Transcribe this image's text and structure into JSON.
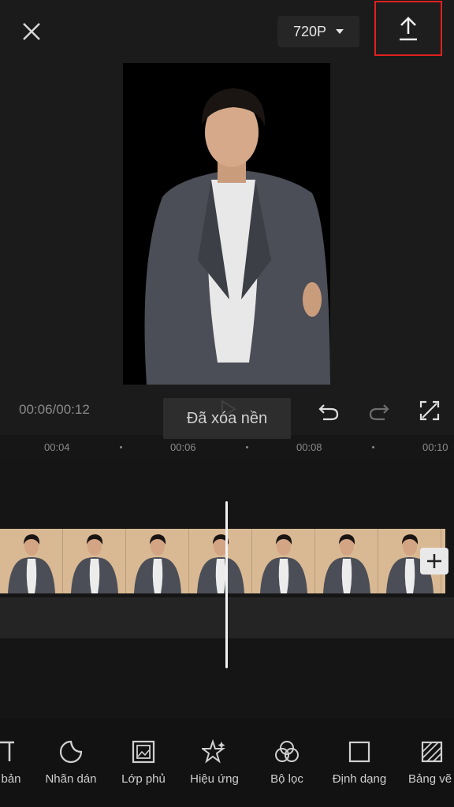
{
  "header": {
    "resolution": "720P"
  },
  "player": {
    "timecode": "00:06/00:12",
    "toast": "Đã xóa nền"
  },
  "ruler": {
    "ticks": [
      "00:04",
      "00:06",
      "00:08",
      "00:10"
    ]
  },
  "toolbar": {
    "items": [
      {
        "label": "bản",
        "icon": "text-icon"
      },
      {
        "label": "Nhãn dán",
        "icon": "sticker-icon"
      },
      {
        "label": "Lớp phủ",
        "icon": "overlay-icon"
      },
      {
        "label": "Hiệu ứng",
        "icon": "effects-icon"
      },
      {
        "label": "Bộ lọc",
        "icon": "filter-icon"
      },
      {
        "label": "Định dạng",
        "icon": "format-icon"
      },
      {
        "label": "Bảng vẽ",
        "icon": "canvas-icon"
      }
    ]
  },
  "colors": {
    "highlight_border": "#e02020",
    "background": "#1b1b1b",
    "clip_bg": "#d9b994"
  }
}
